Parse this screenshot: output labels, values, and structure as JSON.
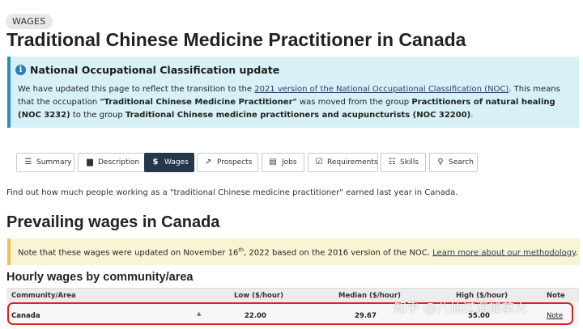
{
  "section_badge": "WAGES",
  "page_title": "Traditional Chinese Medicine Practitioner in Canada",
  "alert": {
    "icon": "info-icon",
    "title": "National Occupational Classification update",
    "text_1": "We have updated this page to reflect the transition to the ",
    "link": "2021 version of the National Occupational Classification (NOC)",
    "text_2": ". This means that the occupation ",
    "occupation": "\"Traditional Chinese Medicine Practitioner\"",
    "text_3": " was moved from the group ",
    "old_group": "Practitioners of natural healing (NOC 3232)",
    "text_4": " to the group ",
    "new_group": "Traditional Chinese medicine practitioners and acupuncturists (NOC 32200)",
    "text_5": "."
  },
  "tabs": [
    {
      "label": "Summary",
      "icon": "list-icon"
    },
    {
      "label": "Description",
      "icon": "book-icon"
    },
    {
      "label": "Wages",
      "icon": "dollar-icon"
    },
    {
      "label": "Prospects",
      "icon": "chart-line-icon"
    },
    {
      "label": "Jobs",
      "icon": "newspaper-icon"
    },
    {
      "label": "Requirements",
      "icon": "checkbox-icon"
    },
    {
      "label": "Skills",
      "icon": "tasks-icon"
    },
    {
      "label": "Search",
      "icon": "search-icon"
    }
  ],
  "active_tab": "Wages",
  "intro": "Find out how much people working as a \"traditional Chinese medicine practitioner\" earned last year in Canada.",
  "prevailing_heading": "Prevailing wages in Canada",
  "wage_note": {
    "text_1": "Note that these wages were updated on November 16",
    "sup": "th",
    "text_2": ", 2022 based on the 2016 version of the NOC. ",
    "link": "Learn more about our methodology",
    "text_3": "."
  },
  "hourly_heading": "Hourly wages by community/area",
  "table": {
    "headers": [
      "Community/Area",
      "Low ($/hour)",
      "Median ($/hour)",
      "High ($/hour)",
      "Note"
    ],
    "rows": [
      {
        "area": "Canada",
        "low": "22.00",
        "median": "29.67",
        "high": "55.00",
        "note": "Note"
      }
    ]
  },
  "watermark": "知乎 @八仙过海加拿大",
  "colors": {
    "active_tab": "#26374a",
    "alert_bg": "#d8f1f6",
    "alert_border": "#2a8fbd",
    "note_bg": "#f9f4d4",
    "note_border": "#f0c24a",
    "highlight": "#d7261e",
    "link": "#284162"
  }
}
